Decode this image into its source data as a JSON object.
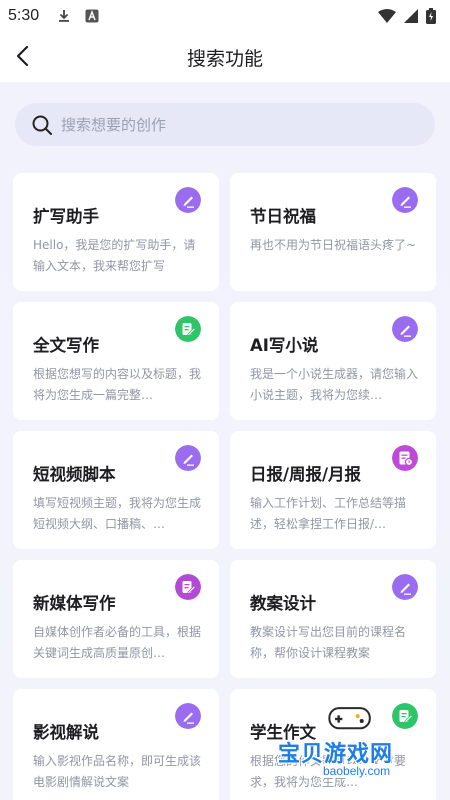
{
  "status_bar": {
    "time": "5:30",
    "icons": [
      "download-icon",
      "a-badge-icon",
      "wifi-icon",
      "signal-icon",
      "battery-icon"
    ]
  },
  "header": {
    "title": "搜索功能",
    "back_icon": "chevron-left-icon"
  },
  "search": {
    "placeholder": "搜索想要的创作",
    "icon": "search-icon"
  },
  "cards": [
    {
      "title": "扩写助手",
      "desc": "Hello，我是您的扩写助手，请输入文本，我来帮您扩写",
      "icon": "pen-icon",
      "icon_color": "#9a6cf0"
    },
    {
      "title": "节日祝福",
      "desc": "再也不用为节日祝福语头疼了~",
      "icon": "pen-icon",
      "icon_color": "#9a6cf0"
    },
    {
      "title": "全文写作",
      "desc": "根据您想写的内容以及标题，我将为您生成一篇完整…",
      "icon": "edit-note-icon",
      "icon_color": "#2ec46a"
    },
    {
      "title": "AI写小说",
      "desc": "我是一个小说生成器，请您输入小说主题，我将为您续…",
      "icon": "pen-icon",
      "icon_color": "#9a6cf0"
    },
    {
      "title": "短视频脚本",
      "desc": "填写短视频主题，我将为您生成短视频大纲、口播稿、…",
      "icon": "pen-icon",
      "icon_color": "#9a6cf0"
    },
    {
      "title": "日报/周报/月报",
      "desc": "输入工作计划、工作总结等描述，轻松拿捏工作日报/…",
      "icon": "report-icon",
      "icon_color": "#c04ad8"
    },
    {
      "title": "新媒体写作",
      "desc": "自媒体创作者必备的工具，根据关键词生成高质量原创…",
      "icon": "edit-note-icon",
      "icon_color": "#b24ad6"
    },
    {
      "title": "教案设计",
      "desc": "教案设计写出您目前的课程名称，帮你设计课程教案",
      "icon": "pen-icon",
      "icon_color": "#9a6cf0"
    },
    {
      "title": "影视解说",
      "desc": "输入影视作品名称，即可生成该电影剧情解说文案",
      "icon": "pen-icon",
      "icon_color": "#9a6cf0"
    },
    {
      "title": "学生作文",
      "desc": "根据您的作文题目以及文章要求，我将为您生成…",
      "icon": "edit-note-icon",
      "icon_color": "#2ec46a"
    }
  ],
  "watermark": {
    "text": "宝贝游戏网",
    "url": "baobely.com"
  }
}
